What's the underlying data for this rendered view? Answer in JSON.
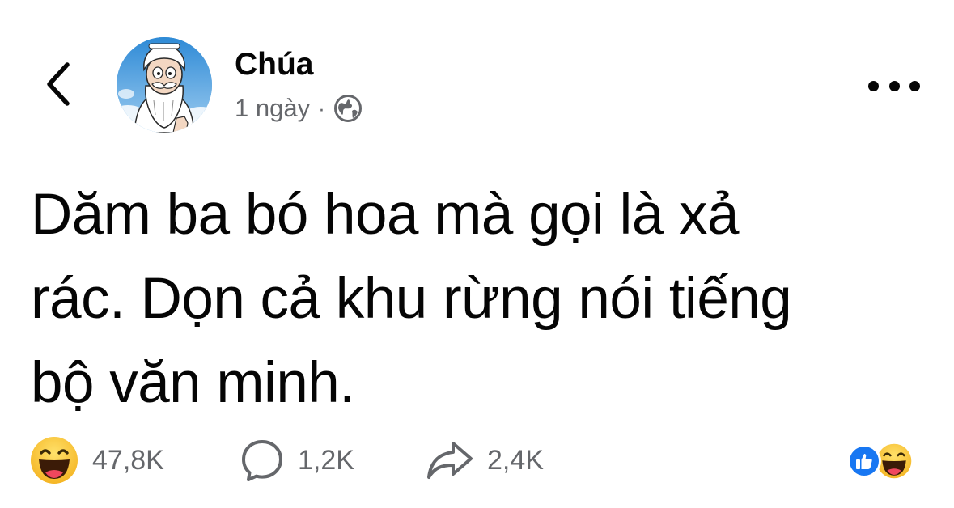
{
  "post": {
    "author": {
      "name": "Chúa",
      "avatar_icon": "god-cartoon-avatar"
    },
    "meta": {
      "time": "1 ngày",
      "separator": "·",
      "privacy_icon": "globe-icon"
    },
    "text_lines": [
      "Dăm ba bó hoa mà gọi là xả",
      "rác. Dọn cả khu rừng nói tiếng",
      "bộ văn minh."
    ],
    "actions": {
      "reaction": {
        "icon": "haha-emoji-icon",
        "count": "47,8K"
      },
      "comment": {
        "icon": "comment-icon",
        "count": "1,2K"
      },
      "share": {
        "icon": "share-icon",
        "count": "2,4K"
      }
    },
    "reaction_summary": [
      "like-icon",
      "haha-emoji-icon"
    ]
  },
  "colors": {
    "text": "#050505",
    "secondary": "#65676b",
    "like_blue": "#1877f2",
    "haha_yellow": "#f7c12f"
  }
}
